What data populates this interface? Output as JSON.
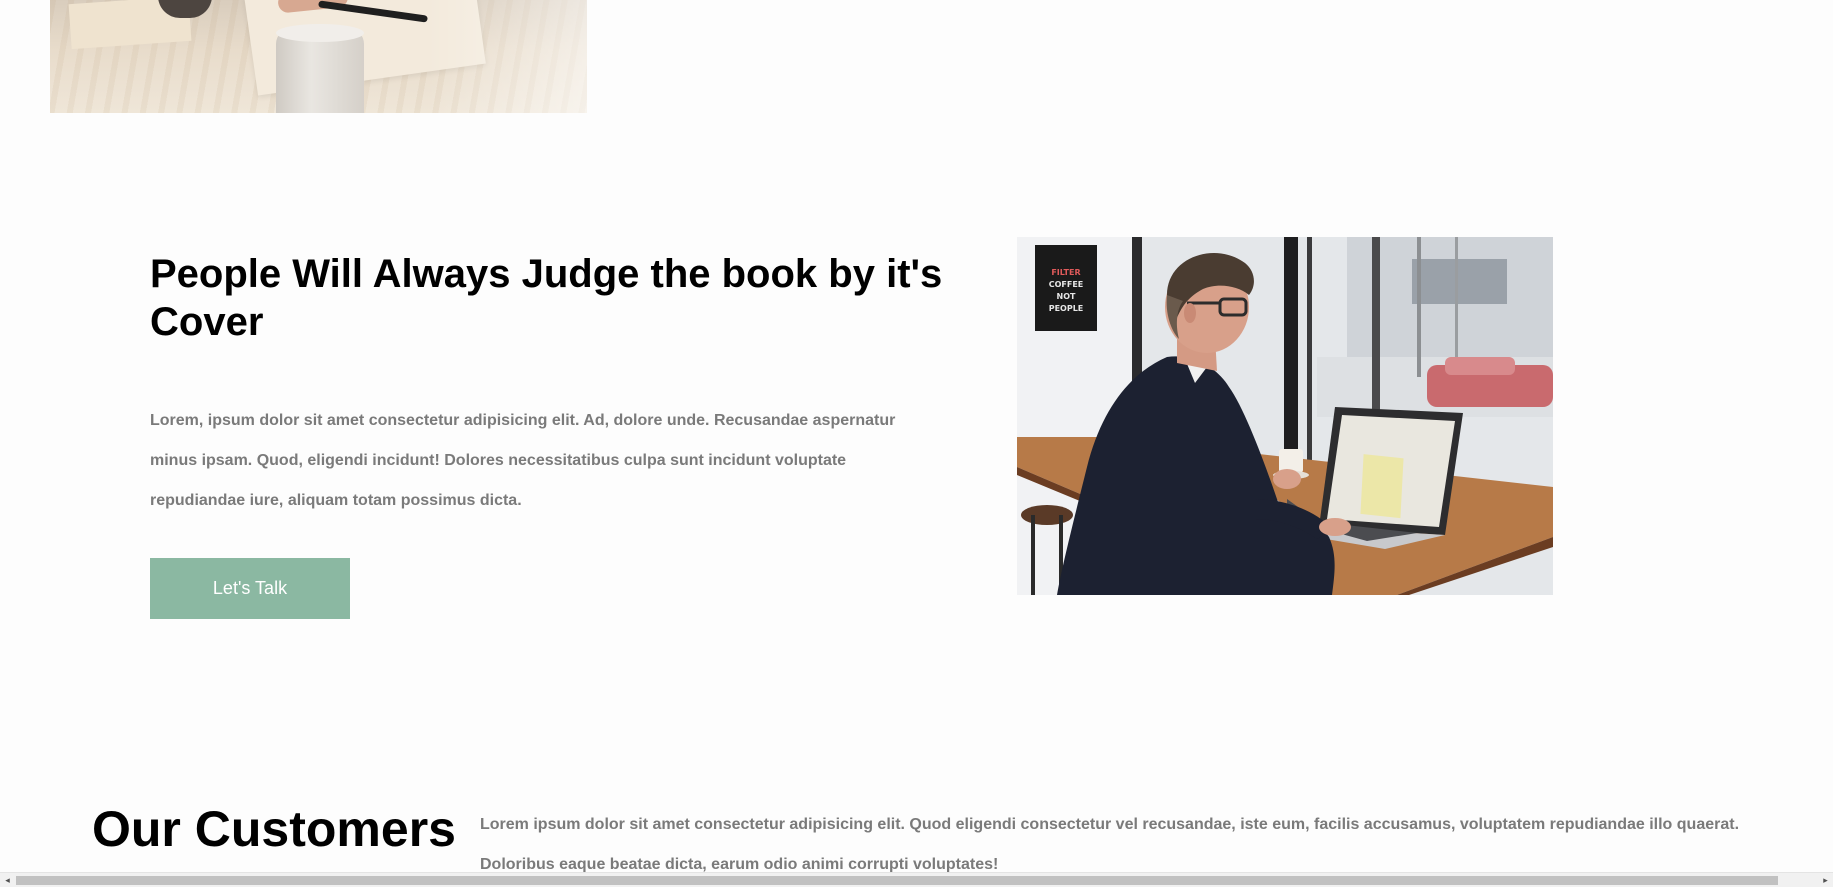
{
  "cover_section": {
    "title": "People Will Always Judge the book by it's Cover",
    "body": "Lorem, ipsum dolor sit amet consectetur adipisicing elit. Ad, dolore unde. Recusandae aspernatur minus ipsam. Quod, eligendi incidunt! Dolores necessitatibus culpa sunt incidunt voluptate repudiandae iure, aliquam totam possimus dicta.",
    "button_label": "Let's Talk",
    "button_color": "#8bb8a2"
  },
  "customers_section": {
    "title": "Our Customers Love Us",
    "body": "Lorem ipsum dolor sit amet consectetur adipisicing elit. Quod eligendi consectetur vel recusandae, iste eum, facilis accusamus, voluptatem repudiandae illo quaerat. Doloribus eaque beatae dicta, earum odio animi corrupti voluptates!"
  },
  "poster_text": [
    "FILTER",
    "COFFEE",
    "NOT",
    "PEOPLE"
  ],
  "scrollbar": {
    "left_arrow": "◂",
    "right_arrow": "▸"
  },
  "colors": {
    "background": "#fdfdfd",
    "body_text": "#7a7a7a",
    "heading_text": "#000000"
  }
}
